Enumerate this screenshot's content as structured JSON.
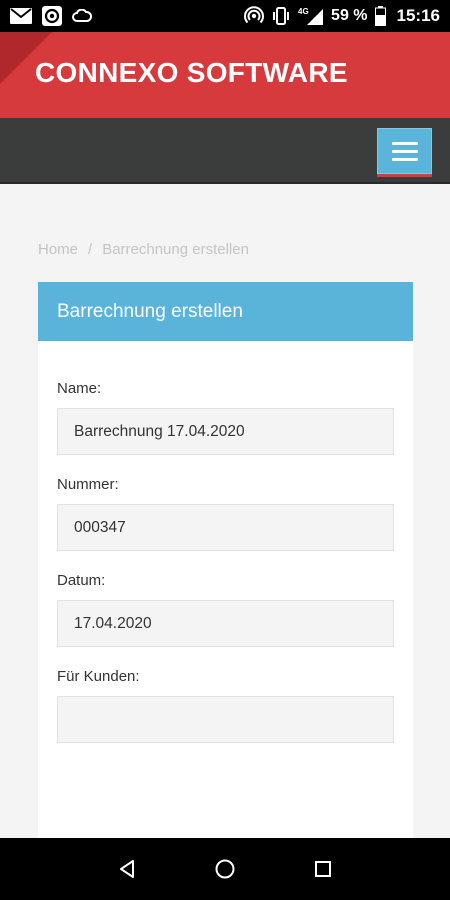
{
  "status_bar": {
    "battery_percent": "59 %",
    "network": "4G",
    "time": "15:16",
    "left_icons": [
      "gmail-icon",
      "app-icon",
      "cloud-icon"
    ],
    "right_icons": [
      "hotspot-icon",
      "vibrate-icon",
      "signal-icon",
      "battery-icon"
    ]
  },
  "header": {
    "brand": "CONNEXO SOFTWARE",
    "brand_color": "#d63a3d"
  },
  "nav": {
    "menu_icon": "hamburger-icon",
    "accent": "#5bb4da"
  },
  "breadcrumb": {
    "home": "Home",
    "separator": "/",
    "current": "Barrechnung erstellen"
  },
  "form": {
    "title": "Barrechnung erstellen",
    "fields": {
      "name": {
        "label": "Name:",
        "value": "Barrechnung 17.04.2020"
      },
      "number": {
        "label": "Nummer:",
        "value": "000347"
      },
      "date": {
        "label": "Datum:",
        "value": "17.04.2020"
      },
      "customer": {
        "label": "Für Kunden:",
        "value": ""
      }
    }
  },
  "system_nav": [
    "back-icon",
    "home-icon",
    "recents-icon"
  ]
}
